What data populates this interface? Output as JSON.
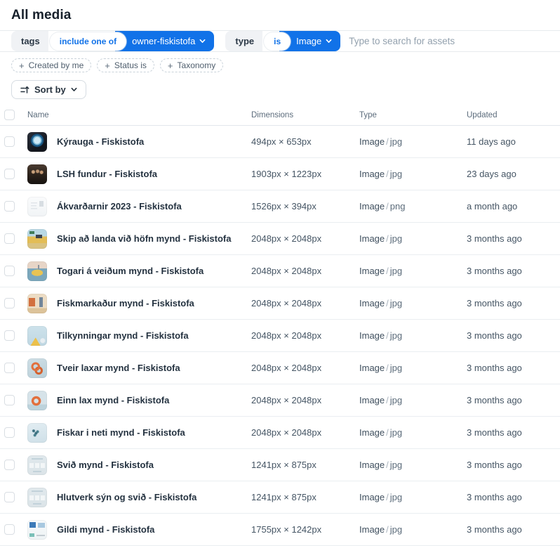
{
  "page": {
    "title": "All media"
  },
  "filters": {
    "plus": "+",
    "tags": {
      "field": "tags",
      "operator": "include one of",
      "value": "owner-fiskistofa"
    },
    "type": {
      "field": "type",
      "operator": "is",
      "value": "Image"
    },
    "search_placeholder": "Type to search for assets",
    "add_filters": [
      {
        "label": "Created by me"
      },
      {
        "label": "Status is"
      },
      {
        "label": "Taxonomy"
      }
    ]
  },
  "toolbar": {
    "sort_label": "Sort by"
  },
  "table": {
    "columns": [
      "Name",
      "Dimensions",
      "Type",
      "Updated"
    ],
    "type_separator": "/",
    "rows": [
      {
        "name": "Kýrauga - Fiskistofa",
        "dimensions": "494px × 653px",
        "type": "Image",
        "format": "jpg",
        "updated": "11 days ago",
        "thumb": "porthole"
      },
      {
        "name": "LSH fundur - Fiskistofa",
        "dimensions": "1903px × 1223px",
        "type": "Image",
        "format": "jpg",
        "updated": "23 days ago",
        "thumb": "group-photo"
      },
      {
        "name": "Ákvarðarnir 2023 - Fiskistofa",
        "dimensions": "1526px × 394px",
        "type": "Image",
        "format": "png",
        "updated": "a month ago",
        "thumb": "document"
      },
      {
        "name": "Skip að landa við höfn mynd - Fiskistofa",
        "dimensions": "2048px × 2048px",
        "type": "Image",
        "format": "jpg",
        "updated": "3 months ago",
        "thumb": "ship-harbor"
      },
      {
        "name": "Togari á veiðum mynd - Fiskistofa",
        "dimensions": "2048px × 2048px",
        "type": "Image",
        "format": "jpg",
        "updated": "3 months ago",
        "thumb": "trawler"
      },
      {
        "name": "Fiskmarkaður mynd - Fiskistofa",
        "dimensions": "2048px × 2048px",
        "type": "Image",
        "format": "jpg",
        "updated": "3 months ago",
        "thumb": "fish-market"
      },
      {
        "name": "Tilkynningar mynd - Fiskistofa",
        "dimensions": "2048px × 2048px",
        "type": "Image",
        "format": "jpg",
        "updated": "3 months ago",
        "thumb": "announcement"
      },
      {
        "name": "Tveir laxar mynd - Fiskistofa",
        "dimensions": "2048px × 2048px",
        "type": "Image",
        "format": "jpg",
        "updated": "3 months ago",
        "thumb": "two-salmon"
      },
      {
        "name": "Einn lax mynd - Fiskistofa",
        "dimensions": "2048px × 2048px",
        "type": "Image",
        "format": "jpg",
        "updated": "3 months ago",
        "thumb": "one-salmon"
      },
      {
        "name": "Fiskar i neti mynd - Fiskistofa",
        "dimensions": "2048px × 2048px",
        "type": "Image",
        "format": "jpg",
        "updated": "3 months ago",
        "thumb": "fish-net"
      },
      {
        "name": "Svið mynd - Fiskistofa",
        "dimensions": "1241px × 875px",
        "type": "Image",
        "format": "jpg",
        "updated": "3 months ago",
        "thumb": "diagram-1"
      },
      {
        "name": "Hlutverk sýn og svið - Fiskistofa",
        "dimensions": "1241px × 875px",
        "type": "Image",
        "format": "jpg",
        "updated": "3 months ago",
        "thumb": "diagram-2"
      },
      {
        "name": "Gildi mynd - Fiskistofa",
        "dimensions": "1755px × 1242px",
        "type": "Image",
        "format": "jpg",
        "updated": "3 months ago",
        "thumb": "values-diagram"
      }
    ]
  },
  "colors": {
    "accent_blue": "#1172e8",
    "pill_gray": "#f0f2f5",
    "border": "#e7ebee"
  }
}
